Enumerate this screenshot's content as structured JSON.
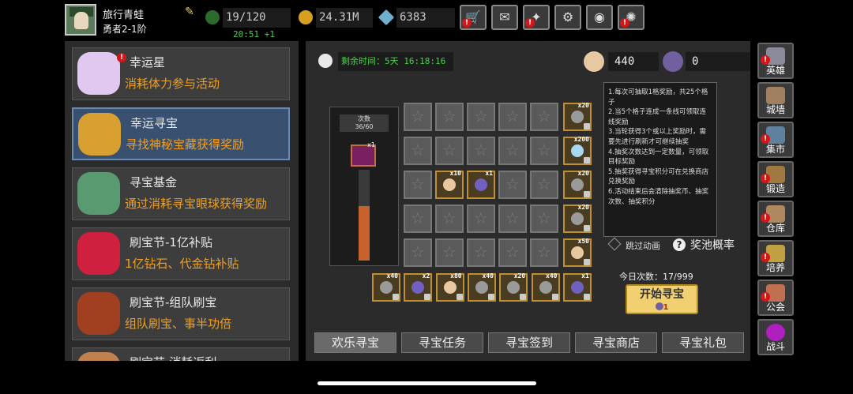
{
  "player": {
    "name": "旅行青蛙",
    "rank": "勇者2-1阶"
  },
  "stats": {
    "stamina": "19/120",
    "stamina_timer": "20:51 +1",
    "gold": "24.31M",
    "diamonds": "6383"
  },
  "top_buttons": [
    {
      "name": "shop",
      "icon": "cart-icon",
      "badge": true
    },
    {
      "name": "mail",
      "icon": "envelope-icon",
      "badge": false
    },
    {
      "name": "events",
      "icon": "gamepad-icon",
      "badge": true
    },
    {
      "name": "settings",
      "icon": "gear-icon",
      "badge": false
    },
    {
      "name": "spectrum",
      "icon": "rainbow-wheel-icon",
      "badge": false
    },
    {
      "name": "fireworks",
      "icon": "fireworks-icon",
      "badge": true
    }
  ],
  "left_menu": [
    {
      "title": "幸运星",
      "subtitle": "消耗体力参与活动",
      "icon": "lucky-star-icon",
      "badge": true,
      "selected": false
    },
    {
      "title": "幸运寻宝",
      "subtitle": "寻找神秘宝藏获得奖励",
      "icon": "treasure-medallion-icon",
      "badge": false,
      "selected": true
    },
    {
      "title": "寻宝基金",
      "subtitle": "通过消耗寻宝眼球获得奖励",
      "icon": "fund-bag-icon",
      "badge": false,
      "selected": false
    },
    {
      "title": "刷宝节-1亿补贴",
      "subtitle": "1亿钻石、代金钻补贴",
      "icon": "red-flower-icon",
      "badge": false,
      "selected": false
    },
    {
      "title": "刷宝节-组队刷宝",
      "subtitle": "组队刷宝、事半功倍",
      "icon": "treasure-chest-icon",
      "badge": false,
      "selected": false
    },
    {
      "title": "刷宝节-消耗返利",
      "subtitle": "",
      "icon": "scroll-icon",
      "badge": false,
      "selected": false
    }
  ],
  "event": {
    "remaining_label": "剩余时间：",
    "remaining_value": "5天 16:18:16",
    "currency1": "440",
    "currency2": "0",
    "count_label": "次数",
    "count_value": "36/60",
    "progress_fraction": 0.6,
    "prize_qty": "x1",
    "rules": [
      "1.每次可抽取1格奖励，共25个格子",
      "2.当5个格子连成一条线可领取连线奖励",
      "3.当轮获得3个或以上奖励时，需要先进行刷新才可继续抽奖",
      "4.抽奖次数达到一定数量，可领取目标奖励",
      "5.抽奖获得寻宝积分可在兑换商店兑换奖励",
      "6.活动结束后会清除抽奖币、抽奖次数、抽奖积分"
    ],
    "skip_animation": "跳过动画",
    "pool_odds": "奖池概率",
    "daily_count": "今日次数：17/999",
    "start_button": "开始寻宝",
    "start_cost": "1",
    "grid": [
      [
        {
          "qty": ""
        },
        {
          "qty": ""
        },
        {
          "qty": ""
        },
        {
          "qty": ""
        },
        {
          "qty": ""
        }
      ],
      [
        {
          "qty": ""
        },
        {
          "qty": ""
        },
        {
          "qty": ""
        },
        {
          "qty": ""
        },
        {
          "qty": ""
        }
      ],
      [
        {
          "qty": ""
        },
        {
          "qty": "x10",
          "icon": "peach-orb-icon"
        },
        {
          "qty": "x1",
          "icon": "purple-orb-icon"
        },
        {
          "qty": ""
        },
        {
          "qty": ""
        }
      ],
      [
        {
          "qty": ""
        },
        {
          "qty": ""
        },
        {
          "qty": ""
        },
        {
          "qty": ""
        },
        {
          "qty": ""
        }
      ],
      [
        {
          "qty": ""
        },
        {
          "qty": ""
        },
        {
          "qty": ""
        },
        {
          "qty": ""
        },
        {
          "qty": ""
        }
      ]
    ],
    "row_rewards": [
      {
        "qty": "x20",
        "icon": "hammer-icon"
      },
      {
        "qty": "x200",
        "icon": "diamond-icon"
      },
      {
        "qty": "x20",
        "icon": "hammer-icon"
      },
      {
        "qty": "x20",
        "icon": "hammer-icon"
      },
      {
        "qty": "x50",
        "icon": "peach-orb-icon"
      }
    ],
    "col_rewards": [
      {
        "qty": "x40",
        "icon": "hammer-icon"
      },
      {
        "qty": "x2",
        "icon": "purple-orb-icon"
      },
      {
        "qty": "x80",
        "icon": "peach-orb-icon"
      },
      {
        "qty": "x40",
        "icon": "hammer-icon"
      },
      {
        "qty": "x20",
        "icon": "hammer-icon"
      },
      {
        "qty": "x40",
        "icon": "hammer-icon"
      },
      {
        "qty": "x1",
        "icon": "purple-orb-icon"
      }
    ]
  },
  "bottom_tabs": [
    "欢乐寻宝",
    "寻宝任务",
    "寻宝签到",
    "寻宝商店",
    "寻宝礼包"
  ],
  "sidebar": [
    {
      "label": "英雄",
      "icon": "helmet-icon",
      "badge": true
    },
    {
      "label": "城墙",
      "icon": "wall-icon",
      "badge": false
    },
    {
      "label": "集市",
      "icon": "market-icon",
      "badge": true
    },
    {
      "label": "锻造",
      "icon": "anvil-icon",
      "badge": true
    },
    {
      "label": "仓库",
      "icon": "warehouse-icon",
      "badge": true
    },
    {
      "label": "培养",
      "icon": "trophy-icon",
      "badge": true
    },
    {
      "label": "公会",
      "icon": "guild-icon",
      "badge": true
    },
    {
      "label": "战斗",
      "icon": "portal-icon",
      "badge": false
    }
  ],
  "colors": {
    "accent_orange": "#f0a020",
    "timer_green": "#4cd04c",
    "badge_red": "#d01818",
    "button_yellow": "#f0d070",
    "progress_fill": "#c8622c"
  }
}
